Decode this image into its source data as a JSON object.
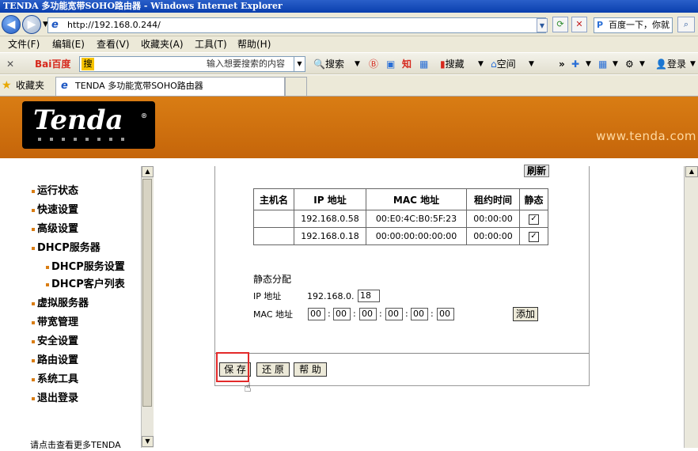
{
  "window": {
    "title": "TENDA 多功能宽带SOHO路由器 - Windows Internet Explorer"
  },
  "browser": {
    "address": "http://192.168.0.244/",
    "search_placeholder": "百度一下，你就",
    "menu": [
      "文件(F)",
      "编辑(E)",
      "查看(V)",
      "收藏夹(A)",
      "工具(T)",
      "帮助(H)"
    ],
    "toolbar": {
      "baidu_logo": "Bai百度",
      "baidu_input_tag": "搜",
      "baidu_hint": "输入想要搜索的内容",
      "search_btn": "搜索",
      "zhi": "知",
      "search2": "搜藏",
      "space": "空间",
      "login": "登录"
    },
    "favorites_label": "收藏夹",
    "tab_title": "TENDA 多功能宽带SOHO路由器"
  },
  "header": {
    "logo": "Tenda",
    "website": "www.tenda.com"
  },
  "sidebar": {
    "items": [
      {
        "label": "运行状态"
      },
      {
        "label": "快速设置"
      },
      {
        "label": "高级设置"
      },
      {
        "label": "DHCP服务器"
      },
      {
        "label": "DHCP服务设置"
      },
      {
        "label": "DHCP客户列表"
      },
      {
        "label": "虚拟服务器"
      },
      {
        "label": "带宽管理"
      },
      {
        "label": "安全设置"
      },
      {
        "label": "路由设置"
      },
      {
        "label": "系统工具"
      },
      {
        "label": "退出登录"
      }
    ],
    "footer": "请点击查看更多TENDA"
  },
  "content": {
    "refresh": "刷新",
    "table": {
      "headers": [
        "主机名",
        "IP 地址",
        "MAC 地址",
        "租约时间",
        "静态"
      ],
      "rows": [
        {
          "host": "",
          "ip": "192.168.0.58",
          "mac": "00:E0:4C:B0:5F:23",
          "lease": "00:00:00",
          "static": "✓"
        },
        {
          "host": "",
          "ip": "192.168.0.18",
          "mac": "00:00:00:00:00:00",
          "lease": "00:00:00",
          "static": "✓"
        }
      ]
    },
    "static": {
      "title": "静态分配",
      "ip_label": "IP 地址",
      "ip_prefix": "192.168.0.",
      "ip_value": "18",
      "mac_label": "MAC 地址",
      "mac": [
        "00",
        "00",
        "00",
        "00",
        "00",
        "00"
      ],
      "sep": ":",
      "add": "添加"
    },
    "buttons": {
      "save": "保 存",
      "restore": "还 原",
      "help": "帮 助"
    }
  }
}
